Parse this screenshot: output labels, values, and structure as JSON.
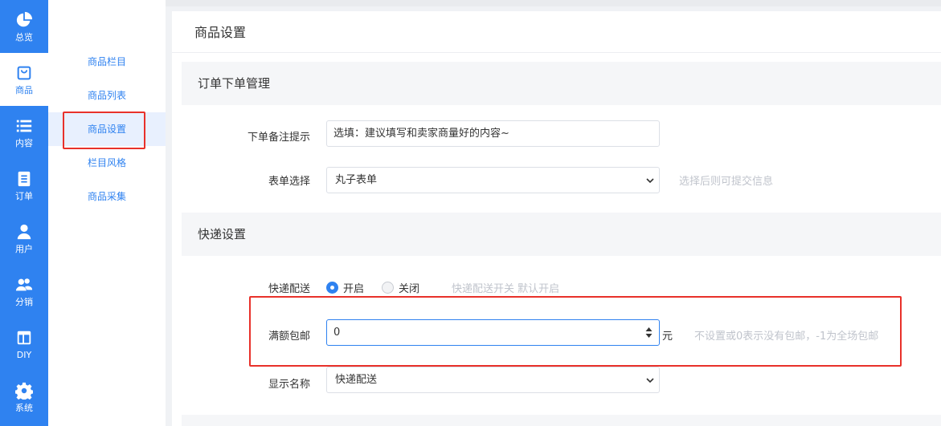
{
  "nav": {
    "items": [
      {
        "label": "总览",
        "icon": "pie-chart-icon"
      },
      {
        "label": "商品",
        "icon": "shopping-bag-icon"
      },
      {
        "label": "内容",
        "icon": "list-icon"
      },
      {
        "label": "订单",
        "icon": "document-icon"
      },
      {
        "label": "用户",
        "icon": "user-icon"
      },
      {
        "label": "分销",
        "icon": "group-icon"
      },
      {
        "label": "DIY",
        "icon": "layout-icon"
      },
      {
        "label": "系统",
        "icon": "gear-icon"
      }
    ]
  },
  "submenu": {
    "items": [
      {
        "label": "商品栏目"
      },
      {
        "label": "商品列表"
      },
      {
        "label": "商品设置"
      },
      {
        "label": "栏目风格"
      },
      {
        "label": "商品采集"
      }
    ]
  },
  "page": {
    "title": "商品设置"
  },
  "order_section": {
    "title": "订单下单管理",
    "remark_label": "下单备注提示",
    "remark_value": "选填：建议填写和卖家商量好的内容~",
    "form_label": "表单选择",
    "form_value": "丸子表单",
    "form_hint": "选择后则可提交信息"
  },
  "express_section": {
    "title": "快递设置",
    "delivery_label": "快递配送",
    "option_on": "开启",
    "option_off": "关闭",
    "delivery_hint": "快递配送开关 默认开启",
    "free_label": "满额包邮",
    "free_value": "0",
    "free_unit": "元",
    "free_hint": "不设置或0表示没有包邮，-1为全场包邮",
    "display_label": "显示名称",
    "display_value": "快递配送"
  },
  "colors": {
    "accent": "#2f82f0",
    "highlight": "#e8312a"
  }
}
